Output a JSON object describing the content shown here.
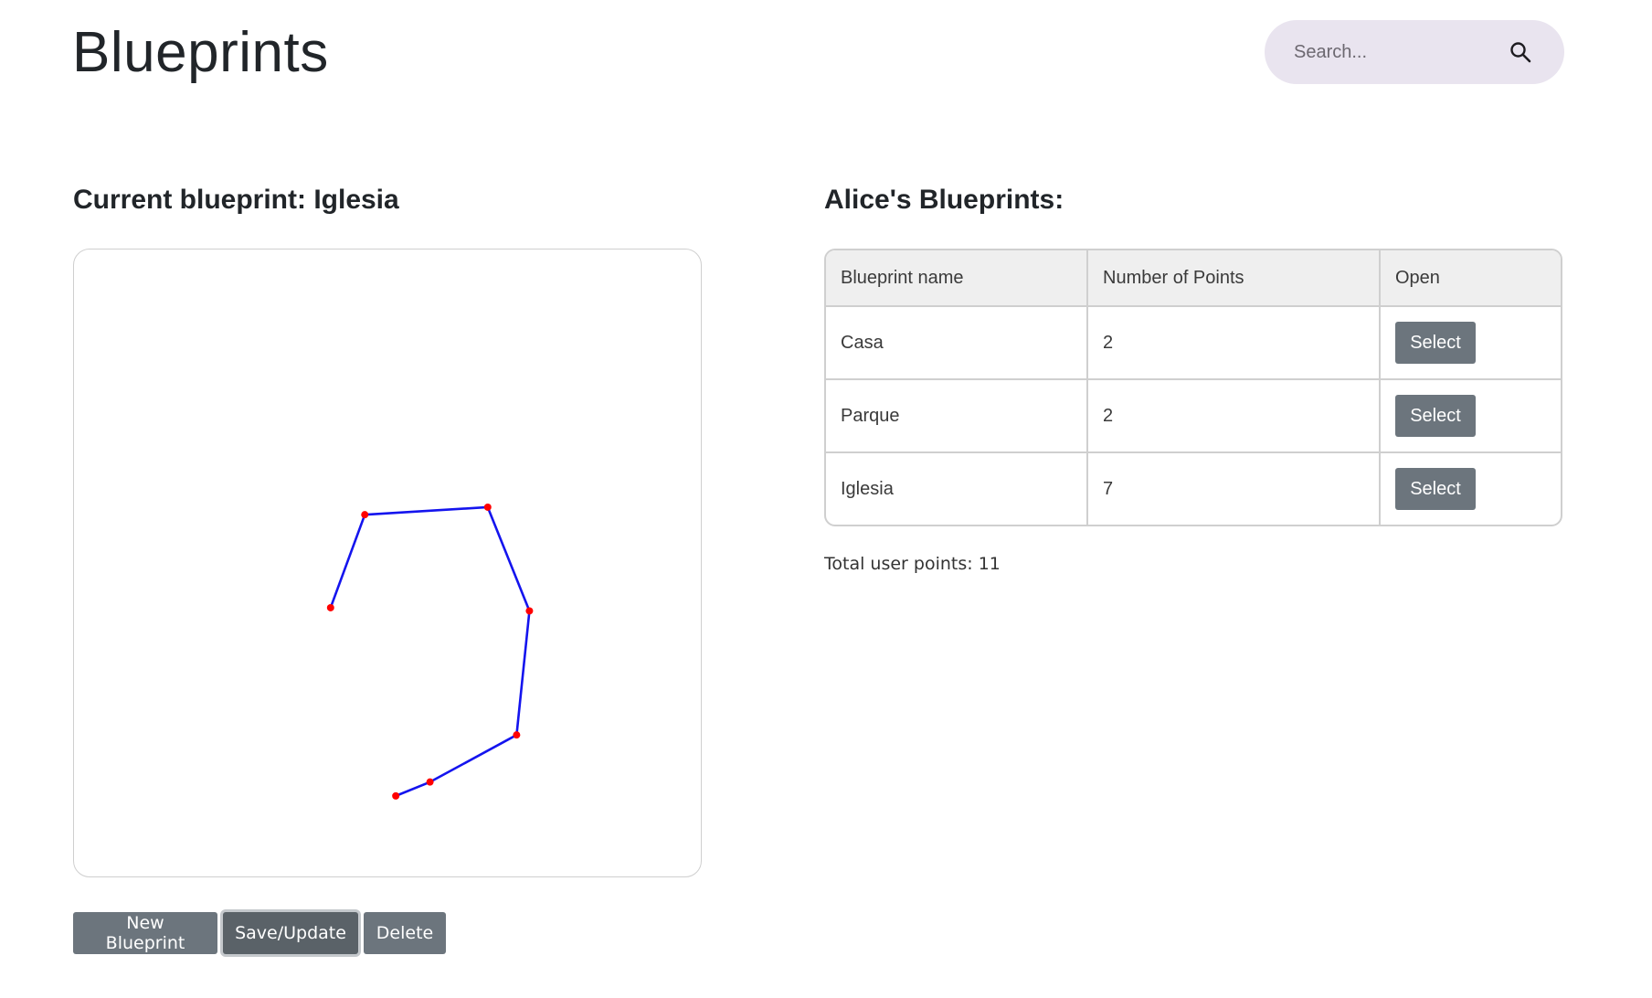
{
  "header": {
    "title": "Blueprints",
    "search_placeholder": "Search..."
  },
  "current": {
    "heading": "Current blueprint: Iglesia",
    "points": [
      [
        240,
        335
      ],
      [
        272,
        248
      ],
      [
        387,
        241
      ],
      [
        426,
        338
      ],
      [
        414,
        454
      ],
      [
        333,
        498
      ],
      [
        301,
        511
      ]
    ]
  },
  "actions": {
    "new_label": "New Blueprint",
    "save_label": "Save/Update",
    "delete_label": "Delete"
  },
  "list": {
    "heading": "Alice's Blueprints:",
    "columns": [
      "Blueprint name",
      "Number of Points",
      "Open"
    ],
    "rows": [
      {
        "name": "Casa",
        "points": "2",
        "action": "Select"
      },
      {
        "name": "Parque",
        "points": "2",
        "action": "Select"
      },
      {
        "name": "Iglesia",
        "points": "7",
        "action": "Select"
      }
    ],
    "total": "Total user points: 11"
  },
  "colors": {
    "line": "#1414ee",
    "point": "#ff0000",
    "button": "#6c757d",
    "search_bg": "#e9e4ef"
  }
}
